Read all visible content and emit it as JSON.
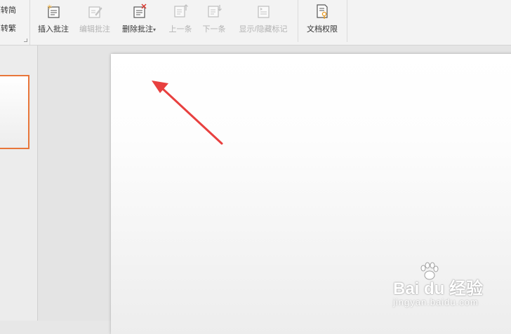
{
  "ribbon": {
    "left_group": {
      "trad_to_simp": "繁转简",
      "simp_to_trad": "简转繁"
    },
    "buttons": {
      "insert_comment": "插入批注",
      "edit_comment": "编辑批注",
      "delete_comment": "删除批注",
      "delete_dropdown": "▾",
      "previous": "上一条",
      "next": "下一条",
      "show_hide_marks": "显示/隐藏标记",
      "document_permissions": "文档权限"
    }
  },
  "watermark": {
    "brand": "Bai du 经验",
    "url": "jingyan.baidu.com"
  },
  "colors": {
    "thumb_selected_border": "#e8763a",
    "annotation_arrow": "#e8403f"
  }
}
